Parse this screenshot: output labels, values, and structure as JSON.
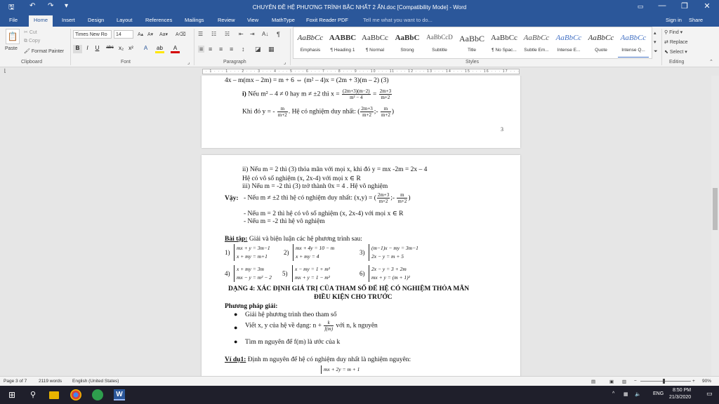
{
  "window": {
    "title": "CHUYÊN ĐỀ HỆ PHƯƠNG TRÌNH BẬC NHẤT 2 ẨN.doc [Compatibility Mode] - Word",
    "minimize": "—",
    "restore": "❐",
    "close": "✕"
  },
  "quick_access": {
    "save": "🖫",
    "undo": "↶",
    "redo": "↷",
    "more": "▾"
  },
  "tabs": [
    "File",
    "Home",
    "Insert",
    "Design",
    "Layout",
    "References",
    "Mailings",
    "Review",
    "View",
    "MathType",
    "Foxit Reader PDF"
  ],
  "tell_me": "Tell me what you want to do...",
  "account": {
    "sign_in": "Sign in",
    "share": "Share"
  },
  "clipboard": {
    "paste": "Paste",
    "cut": "Cut",
    "copy": "Copy",
    "format_painter": "Format Painter",
    "label": "Clipboard"
  },
  "font": {
    "name": "Times New Ro",
    "size": "14",
    "label": "Font",
    "grow": "A▴",
    "shrink": "A▾",
    "case": "Aa▾",
    "clear": "A⌫",
    "bold": "B",
    "italic": "I",
    "underline": "U",
    "strike": "abc",
    "sub": "x₂",
    "sup": "x²",
    "effects": "A",
    "highlight": "ab",
    "color": "A"
  },
  "paragraph": {
    "label": "Paragraph",
    "bullets": "☰",
    "numbering": "☷",
    "multilevel": "☵",
    "decrease": "⇤",
    "increase": "⇥",
    "sort": "A↓",
    "show": "¶",
    "left": "≡",
    "center": "≡",
    "right": "≡",
    "justify": "≡",
    "spacing": "↕",
    "shading": "◪",
    "borders": "▦"
  },
  "styles": {
    "label": "Styles",
    "items": [
      {
        "preview": "AaBbCc",
        "name": "Emphasis"
      },
      {
        "preview": "AABBC",
        "name": "¶ Heading 1"
      },
      {
        "preview": "AaBbCc",
        "name": "¶ Normal"
      },
      {
        "preview": "AaBbC",
        "name": "Strong"
      },
      {
        "preview": "AaBbCcD",
        "name": "Subtitle"
      },
      {
        "preview": "AaBbC",
        "name": "Title"
      },
      {
        "preview": "AaBbCc",
        "name": "¶ No Spac..."
      },
      {
        "preview": "AaBbCc",
        "name": "Subtle Em..."
      },
      {
        "preview": "AaBbCc",
        "name": "Intense E..."
      },
      {
        "preview": "AaBbCc",
        "name": "Quote"
      },
      {
        "preview": "AaBbCc",
        "name": "Intense Q..."
      }
    ]
  },
  "editing": {
    "label": "Editing",
    "find": "Find",
    "replace": "Replace",
    "select": "Select"
  },
  "ruler": "· 1 · · · 1 · · · 2 · · · 3 · · · 4 · · · 5 · · · 6 · · · 7 · · · 8 · · · 9 · · · 10 · · · 11 · · · 12 · · · 13 · · · 14 · · · 15 · · · 16 · · · 17 · · · 18 · · · 19",
  "page1": {
    "line1": "4x – m(mx – 2m) = m + 6 ⇔ (m² – 4)x = (2m + 3)(m – 2)   (3)",
    "line2_a": "i)",
    "line2_b": " Nếu m² – 4 ≠ 0 hay m ≠ ±2 thì x = ",
    "line2_f1n": "(2m+3)(m−2)",
    "line2_f1d": "m² − 4",
    "line2_eq": " = ",
    "line2_f2n": "2m+3",
    "line2_f2d": "m+2",
    "line3_a": "Khi đó y = - ",
    "line3_fn": "m",
    "line3_fd": "m+2",
    "line3_b": ". Hệ có nghiệm duy nhất: (",
    "line3_f2n": "2m+3",
    "line3_f2d": "m+2",
    "line3_c": ";- ",
    "line3_f3n": "m",
    "line3_f3d": "m+2",
    "line3_d": ")",
    "page_number": "3"
  },
  "page2": {
    "l1": "ii) Nếu m = 2 thì (3) thỏa mãn với mọi x, khi đó y = mx -2m = 2x – 4",
    "l2": "Hệ có vô số nghiệm (x, 2x-4) với mọi x ∈ R",
    "l3": "iii) Nếu m = -2 thì (3) trở thành 0x = 4 . Hệ vô nghiệm",
    "vay": "Vậy:",
    "v1a": "- Nếu m ≠ ±2 thì  hệ có nghiệm duy nhất: (x,y) = (",
    "v1fn": "2m+3",
    "v1fd": "m+2",
    "v1b": ";- ",
    "v1f2n": "m",
    "v1f2d": "m+2",
    "v1c": ")",
    "v2": "- Nếu m = 2 thì  hệ có vô số nghiệm (x, 2x-4) với mọi x ∈ R",
    "v3": "- Nếu m = -2 thì hệ vô nghiệm",
    "bt_title": "Bài tập:",
    "bt_text": " Giải và biện luận các hệ phương trình sau:",
    "ex": [
      {
        "n": "1)",
        "a": "mx + y = 3m−1",
        "b": "x + my = m+1"
      },
      {
        "n": "2)",
        "a": "mx + 4y = 10 − m",
        "b": "x + my = 4"
      },
      {
        "n": "3)",
        "a": "(m−1)x − my = 3m−1",
        "b": "2x − y = m + 5"
      },
      {
        "n": "4)",
        "a": "x + my = 3m",
        "b": "mx − y = m² − 2"
      },
      {
        "n": "5)",
        "a": "x − my = 1 + m²",
        "b": "mx + y = 1 − m²"
      },
      {
        "n": "6)",
        "a": "2x − y = 3 + 2m",
        "b": "mx + y = (m + 1)²"
      }
    ],
    "dang4_1": "DẠNG 4:  XÁC ĐỊNH GIÁ TRỊ CỦA THAM SỐ ĐỂ HỆ CÓ NGHIỆM THỎA MÃN",
    "dang4_2": "ĐIỀU KIỆN CHO TRƯỚC",
    "ppg": "Phương pháp giải:",
    "b1": "Giải hệ phương trình theo tham số",
    "b2a": "Viết x, y của hệ về dạng: n + ",
    "b2fn": "k",
    "b2fd": "f(m)",
    "b2b": " với n, k nguyên",
    "b3": "Tìm m nguyên để f(m) là ước của k",
    "vd_title": "Ví dụ1:",
    "vd_text": " Định m nguyên để hệ có nghiệm duy nhất là nghiệm nguyên:",
    "vd_sys": "mx + 2y = m + 1"
  },
  "status": {
    "page": "Page 3 of 7",
    "words": "2119 words",
    "lang": "English (United States)",
    "zoom": "90%"
  },
  "taskbar": {
    "lang": "ENG",
    "time": "8:50 PM",
    "date": "21/3/2020"
  }
}
